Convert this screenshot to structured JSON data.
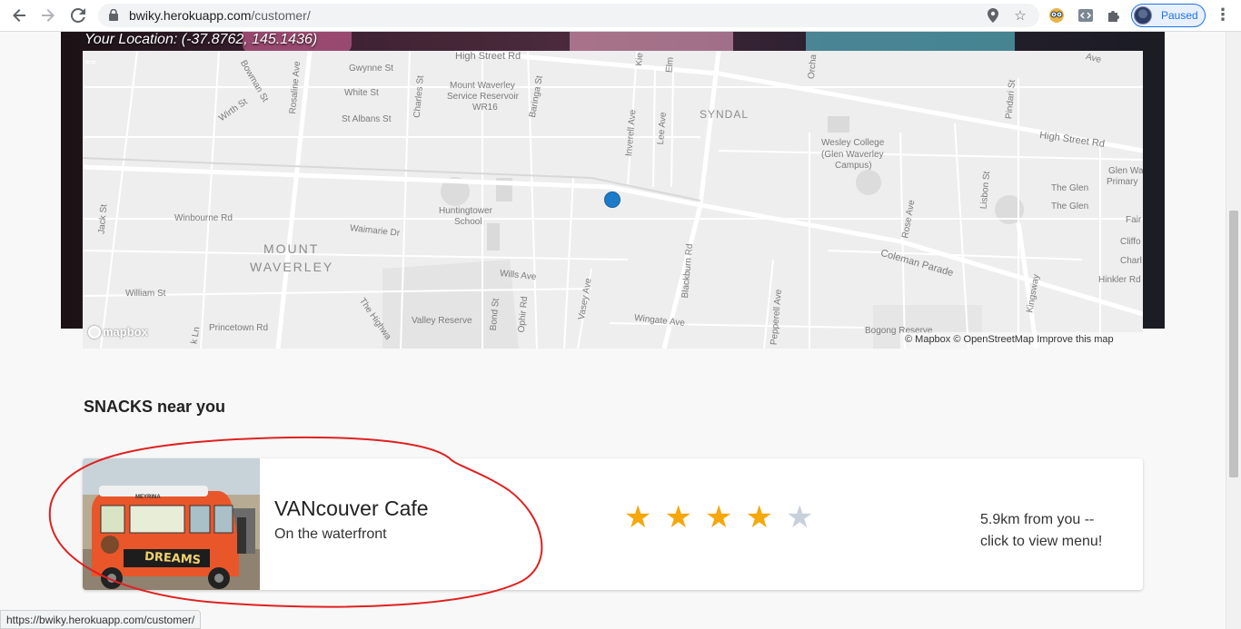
{
  "browser": {
    "url_host": "bwiky.herokuapp.com",
    "url_path": "/customer/",
    "profile_label": "Paused"
  },
  "hero": {
    "location_text": "Your Location: (-37.8762, 145.1436)",
    "marker_text": "=="
  },
  "map": {
    "labels": {
      "gwynne": "Gwynne St",
      "white": "White St",
      "stalbans": "St Albans St",
      "highstreet": "High Street Rd",
      "highstreet2": "High Street Rd",
      "bowman": "Bowman St",
      "wirth": "Wirth St",
      "rosaline": "Rosaline Ave",
      "charles": "Charles St",
      "baringa": "Baringa St",
      "reservoir1": "Mount Waverley",
      "reservoir2": "Service Reservoir",
      "reservoir3": "WR16",
      "syndal": "SYNDAL",
      "inverell": "Inverell Ave",
      "lee": "Lee Ave",
      "kie": "Kie",
      "elm": "Elm",
      "orch": "Orcha",
      "ave": "Ave",
      "wesley1": "Wesley College",
      "wesley2": "(Glen Waverley",
      "wesley3": "Campus)",
      "pindari": "Pindari St",
      "glenwav1": "Glen Wav",
      "glenwav2": "Primary",
      "lisbon": "Lisbon St",
      "theglen1": "The Glen",
      "theglen2": "The Glen",
      "fair": "Fair",
      "cliff": "Cliffo",
      "charl": "Charl",
      "hinkler": "Hinkler Rd",
      "jack": "Jack St",
      "winbourne": "Winbourne Rd",
      "waimarie": "Waimarie Dr",
      "huntingtower1": "Huntingtower",
      "huntingtower2": "School",
      "mount": "MOUNT",
      "waverley": "WAVERLEY",
      "wills": "Wills Ave",
      "vasey": "Vasey Ave",
      "blackburn": "Blackburn Rd",
      "rose": "Rose Ave",
      "coleman": "Coleman Parade",
      "kingsway": "Kingsway",
      "william": "William St",
      "princetown": "Princetown Rd",
      "klin": "k Ln",
      "highway": "The Highwa",
      "valley": "Valley Reserve",
      "bond": "Bond St",
      "ophir": "Ophir Rd",
      "wingate": "Wingate Ave",
      "pepperell": "Pepperell Ave",
      "bogong": "Bogong Reserve"
    },
    "logo_text": "mapbox",
    "attribution": "© Mapbox © OpenStreetMap Improve this map"
  },
  "section": {
    "title": "SNACKS near you"
  },
  "vans": [
    {
      "name": "VANcouver Cafe",
      "description": "On the waterfront",
      "rating": 4,
      "max_rating": 5,
      "distance_line1": "5.9km from you --",
      "distance_line2": "click to view menu!",
      "photo_signs": [
        "DREAMS",
        "MEYRINA"
      ]
    }
  ],
  "star_glyph": "★",
  "status_url": "https://bwiky.herokuapp.com/customer/",
  "colors": {
    "star_on": "#f5a70c",
    "star_off": "#c8d0dc",
    "map_dot": "#1d7bc8",
    "annotation": "#e02020",
    "profile_accent": "#1a73e8"
  }
}
